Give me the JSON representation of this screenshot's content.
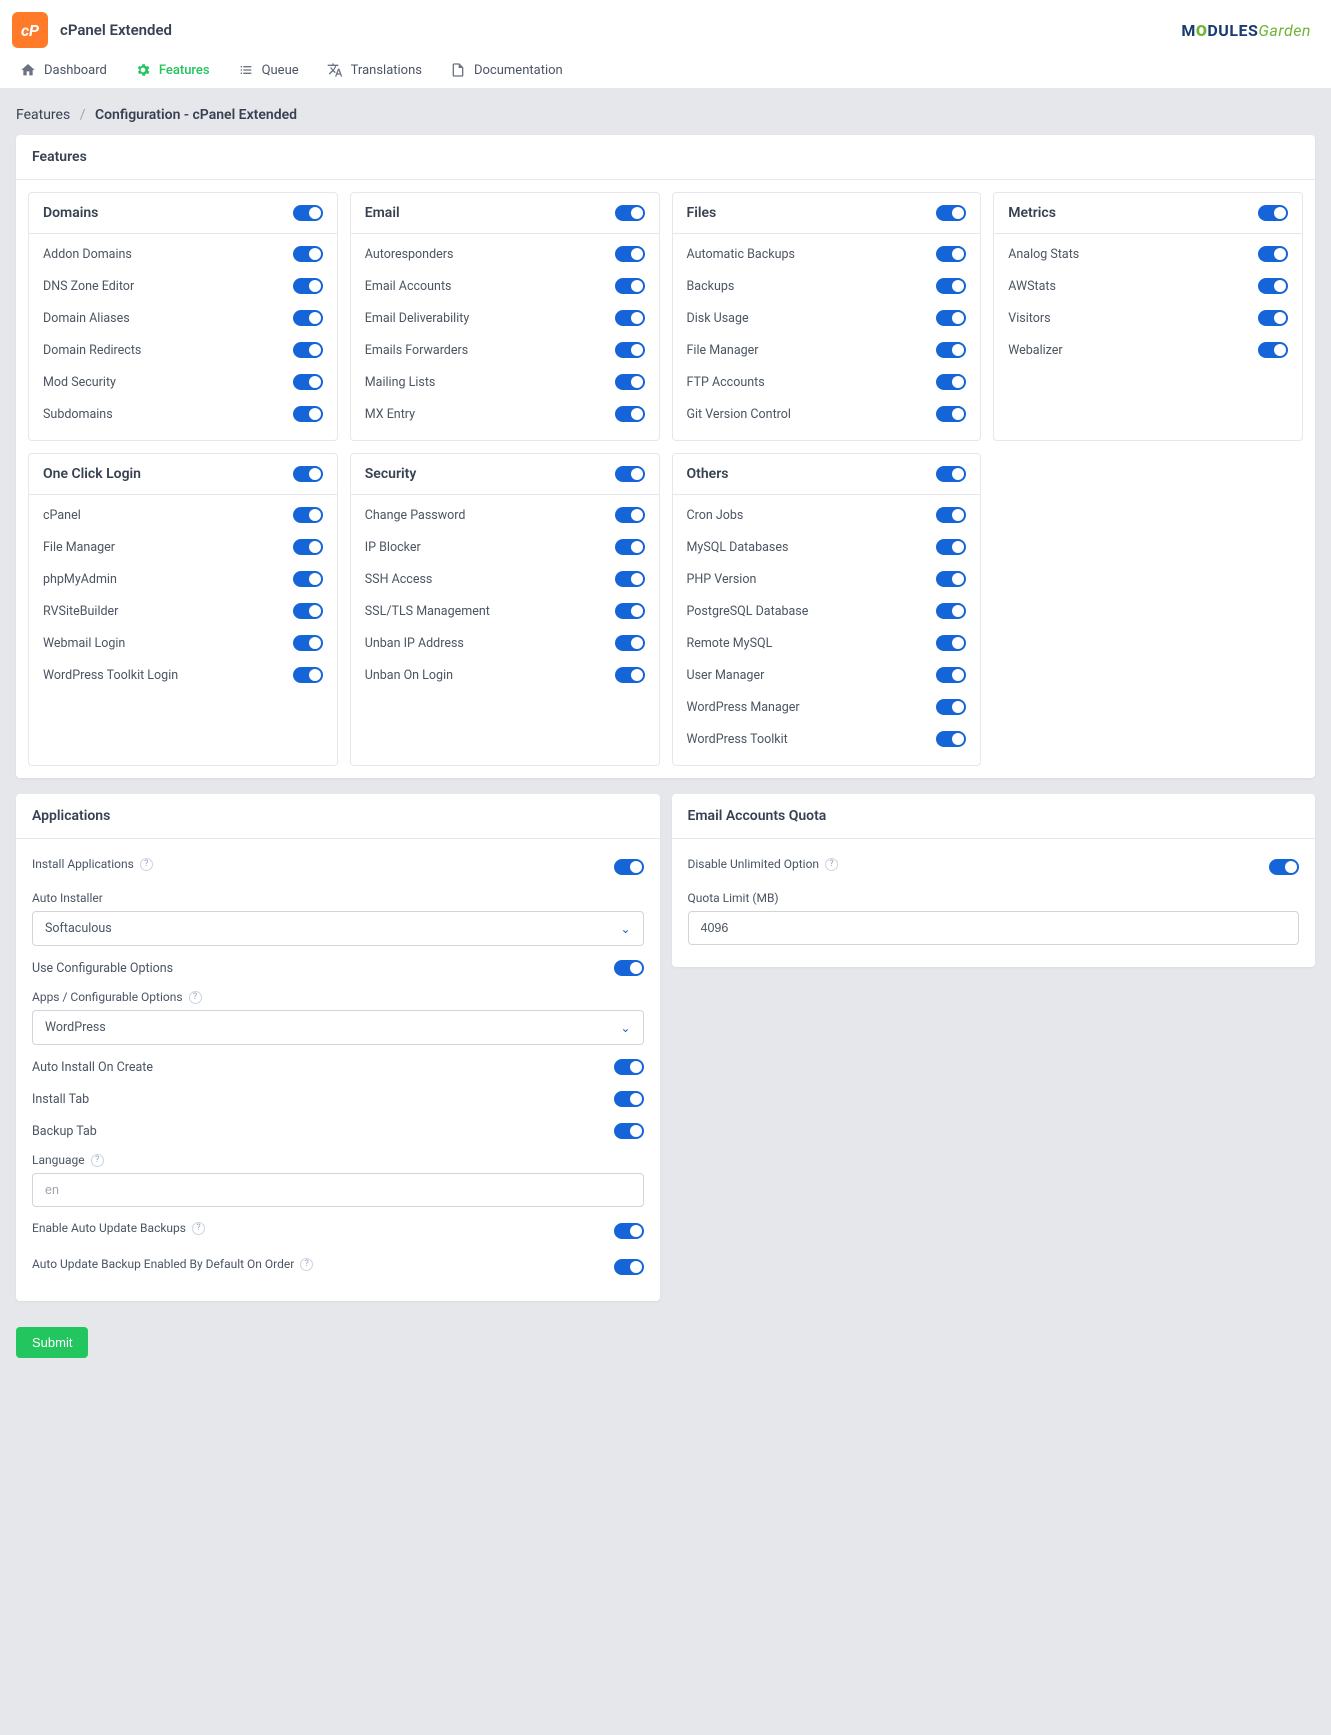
{
  "app_title": "cPanel Extended",
  "brand": {
    "m1": "M",
    "o": "O",
    "m2": "DULES",
    "g": "Garden"
  },
  "tabs": [
    {
      "label": "Dashboard"
    },
    {
      "label": "Features"
    },
    {
      "label": "Queue"
    },
    {
      "label": "Translations"
    },
    {
      "label": "Documentation"
    }
  ],
  "breadcrumb": {
    "root": "Features",
    "current": "Configuration - cPanel Extended"
  },
  "features_panel_title": "Features",
  "groups": [
    {
      "title": "Domains",
      "items": [
        "Addon Domains",
        "DNS Zone Editor",
        "Domain Aliases",
        "Domain Redirects",
        "Mod Security",
        "Subdomains"
      ]
    },
    {
      "title": "Email",
      "items": [
        "Autoresponders",
        "Email Accounts",
        "Email Deliverability",
        "Emails Forwarders",
        "Mailing Lists",
        "MX Entry"
      ]
    },
    {
      "title": "Files",
      "items": [
        "Automatic Backups",
        "Backups",
        "Disk Usage",
        "File Manager",
        "FTP Accounts",
        "Git Version Control"
      ]
    },
    {
      "title": "Metrics",
      "items": [
        "Analog Stats",
        "AWStats",
        "Visitors",
        "Webalizer"
      ]
    },
    {
      "title": "One Click Login",
      "items": [
        "cPanel",
        "File Manager",
        "phpMyAdmin",
        "RVSiteBuilder",
        "Webmail Login",
        "WordPress Toolkit Login"
      ]
    },
    {
      "title": "Security",
      "items": [
        "Change Password",
        "IP Blocker",
        "SSH Access",
        "SSL/TLS Management",
        "Unban IP Address",
        "Unban On Login"
      ]
    },
    {
      "title": "Others",
      "items": [
        "Cron Jobs",
        "MySQL Databases",
        "PHP Version",
        "PostgreSQL Database",
        "Remote MySQL",
        "User Manager",
        "WordPress Manager",
        "WordPress Toolkit"
      ]
    }
  ],
  "applications": {
    "title": "Applications",
    "install_applications": "Install Applications",
    "auto_installer_label": "Auto Installer",
    "auto_installer_value": "Softaculous",
    "use_configurable": "Use Configurable Options",
    "apps_config_label": "Apps / Configurable Options",
    "apps_config_value": "WordPress",
    "auto_install_create": "Auto Install On Create",
    "install_tab": "Install Tab",
    "backup_tab": "Backup Tab",
    "language_label": "Language",
    "language_value": "en",
    "enable_auto_update": "Enable Auto Update Backups",
    "auto_update_default": "Auto Update Backup Enabled By Default On Order"
  },
  "quota": {
    "title": "Email Accounts Quota",
    "disable_unlimited": "Disable Unlimited Option",
    "quota_limit_label": "Quota Limit (MB)",
    "quota_limit_value": "4096"
  },
  "submit_label": "Submit"
}
